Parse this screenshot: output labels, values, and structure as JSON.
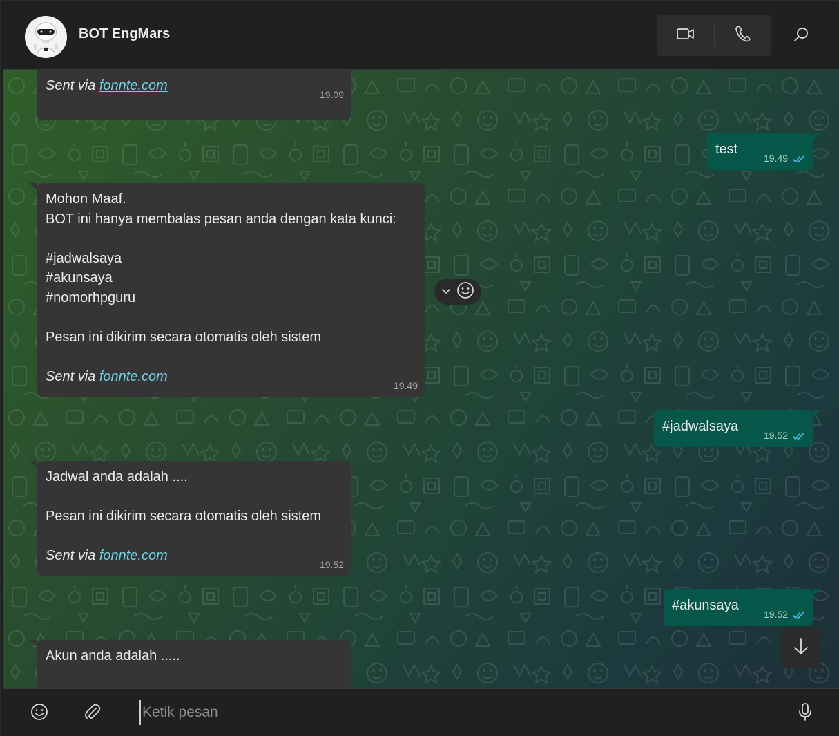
{
  "header": {
    "title": "BOT EngMars",
    "video_icon": "video-camera-icon",
    "call_icon": "phone-icon",
    "search_icon": "search-icon"
  },
  "messages": [
    {
      "direction": "in",
      "lines": [],
      "via_prefix": "Sent via",
      "via_link": "fonnte.com",
      "time": "19.09"
    },
    {
      "direction": "out",
      "lines": [
        "test"
      ],
      "time": "19.49",
      "status": "read"
    },
    {
      "direction": "in",
      "lines": [
        "Mohon Maaf.",
        "BOT ini hanya membalas pesan anda dengan kata kunci:",
        "",
        "#jadwalsaya",
        "#akunsaya",
        "#nomorhpguru",
        "",
        "Pesan ini dikirim secara otomatis oleh sistem",
        ""
      ],
      "via_prefix": "Sent via",
      "via_link": "fonnte.com",
      "time": "19.49"
    },
    {
      "direction": "out",
      "lines": [
        "#jadwalsaya"
      ],
      "time": "19.52",
      "status": "read"
    },
    {
      "direction": "in",
      "lines": [
        "Jadwal anda adalah ....",
        "",
        "Pesan ini dikirim secara otomatis oleh sistem",
        ""
      ],
      "via_prefix": "Sent via",
      "via_link": "fonnte.com",
      "time": "19.52"
    },
    {
      "direction": "out",
      "lines": [
        "#akunsaya"
      ],
      "time": "19.52",
      "status": "read"
    },
    {
      "direction": "in",
      "lines": [
        "Akun anda adalah ....."
      ]
    }
  ],
  "footer": {
    "placeholder": "Ketik pesan",
    "emoji_icon": "smiley-icon",
    "attach_icon": "paperclip-icon",
    "mic_icon": "microphone-icon"
  },
  "colors": {
    "incoming_bubble": "#353535",
    "outgoing_bubble": "#05574a",
    "link": "#6fd2e6",
    "read_tick": "#53bdeb"
  }
}
